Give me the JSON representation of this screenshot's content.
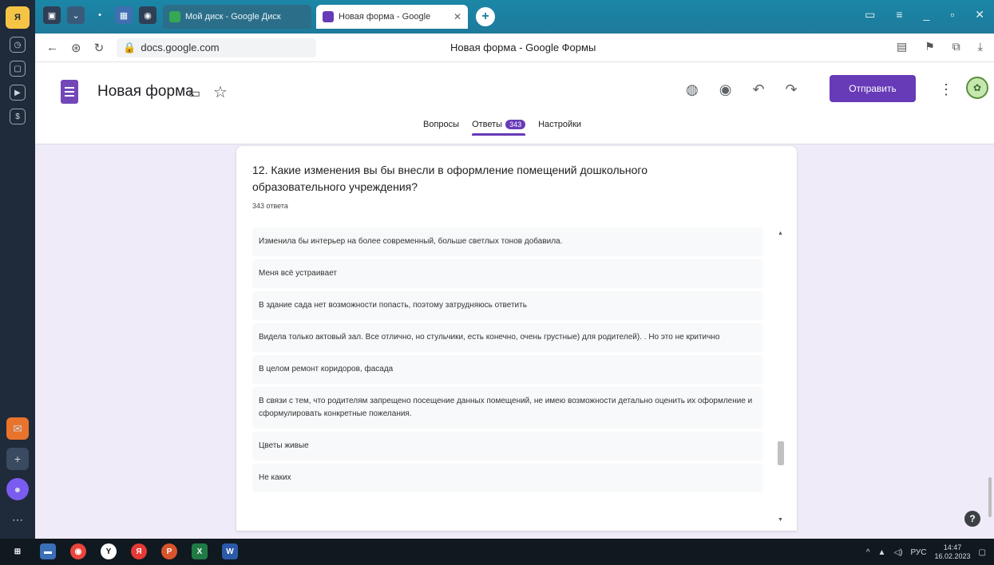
{
  "browser": {
    "tabs": [
      {
        "label": "Мой диск - Google Диск"
      },
      {
        "label": "Новая форма - Google"
      }
    ],
    "url": "docs.google.com",
    "page_title": "Новая форма - Google Формы"
  },
  "form": {
    "title": "Новая форма",
    "send_label": "Отправить",
    "tabs": [
      {
        "label": "Вопросы"
      },
      {
        "label": "Ответы",
        "badge": "343"
      },
      {
        "label": "Настройки"
      }
    ],
    "question": "12. Какие изменения вы бы внесли в оформление помещений дошкольного образовательного учреждения?",
    "answers_count": "343 ответа",
    "answers": [
      "Изменила бы интерьер на более современный, больше светлых тонов добавила.",
      "Меня всё устраивает",
      "В здание сада нет возможности попасть, поэтому затрудняюсь ответить",
      "Видела только актовый зал. Все отлично, но стульчики, есть конечно, очень грустные) для родителей). . Но это не критично",
      "В целом ремонт коридоров, фасада",
      "В связи с тем, что родителям запрещено посещение данных помещений, не имею возможности детально оценить их оформление и сформулировать конкретные пожелания.",
      "Цветы живые",
      "Не каких"
    ]
  },
  "taskbar": {
    "lang": "РУС",
    "time": "14:47",
    "date": "16.02.2023"
  },
  "colors": {
    "accent": "#673ab7",
    "page_bg": "#f0ebf8"
  }
}
